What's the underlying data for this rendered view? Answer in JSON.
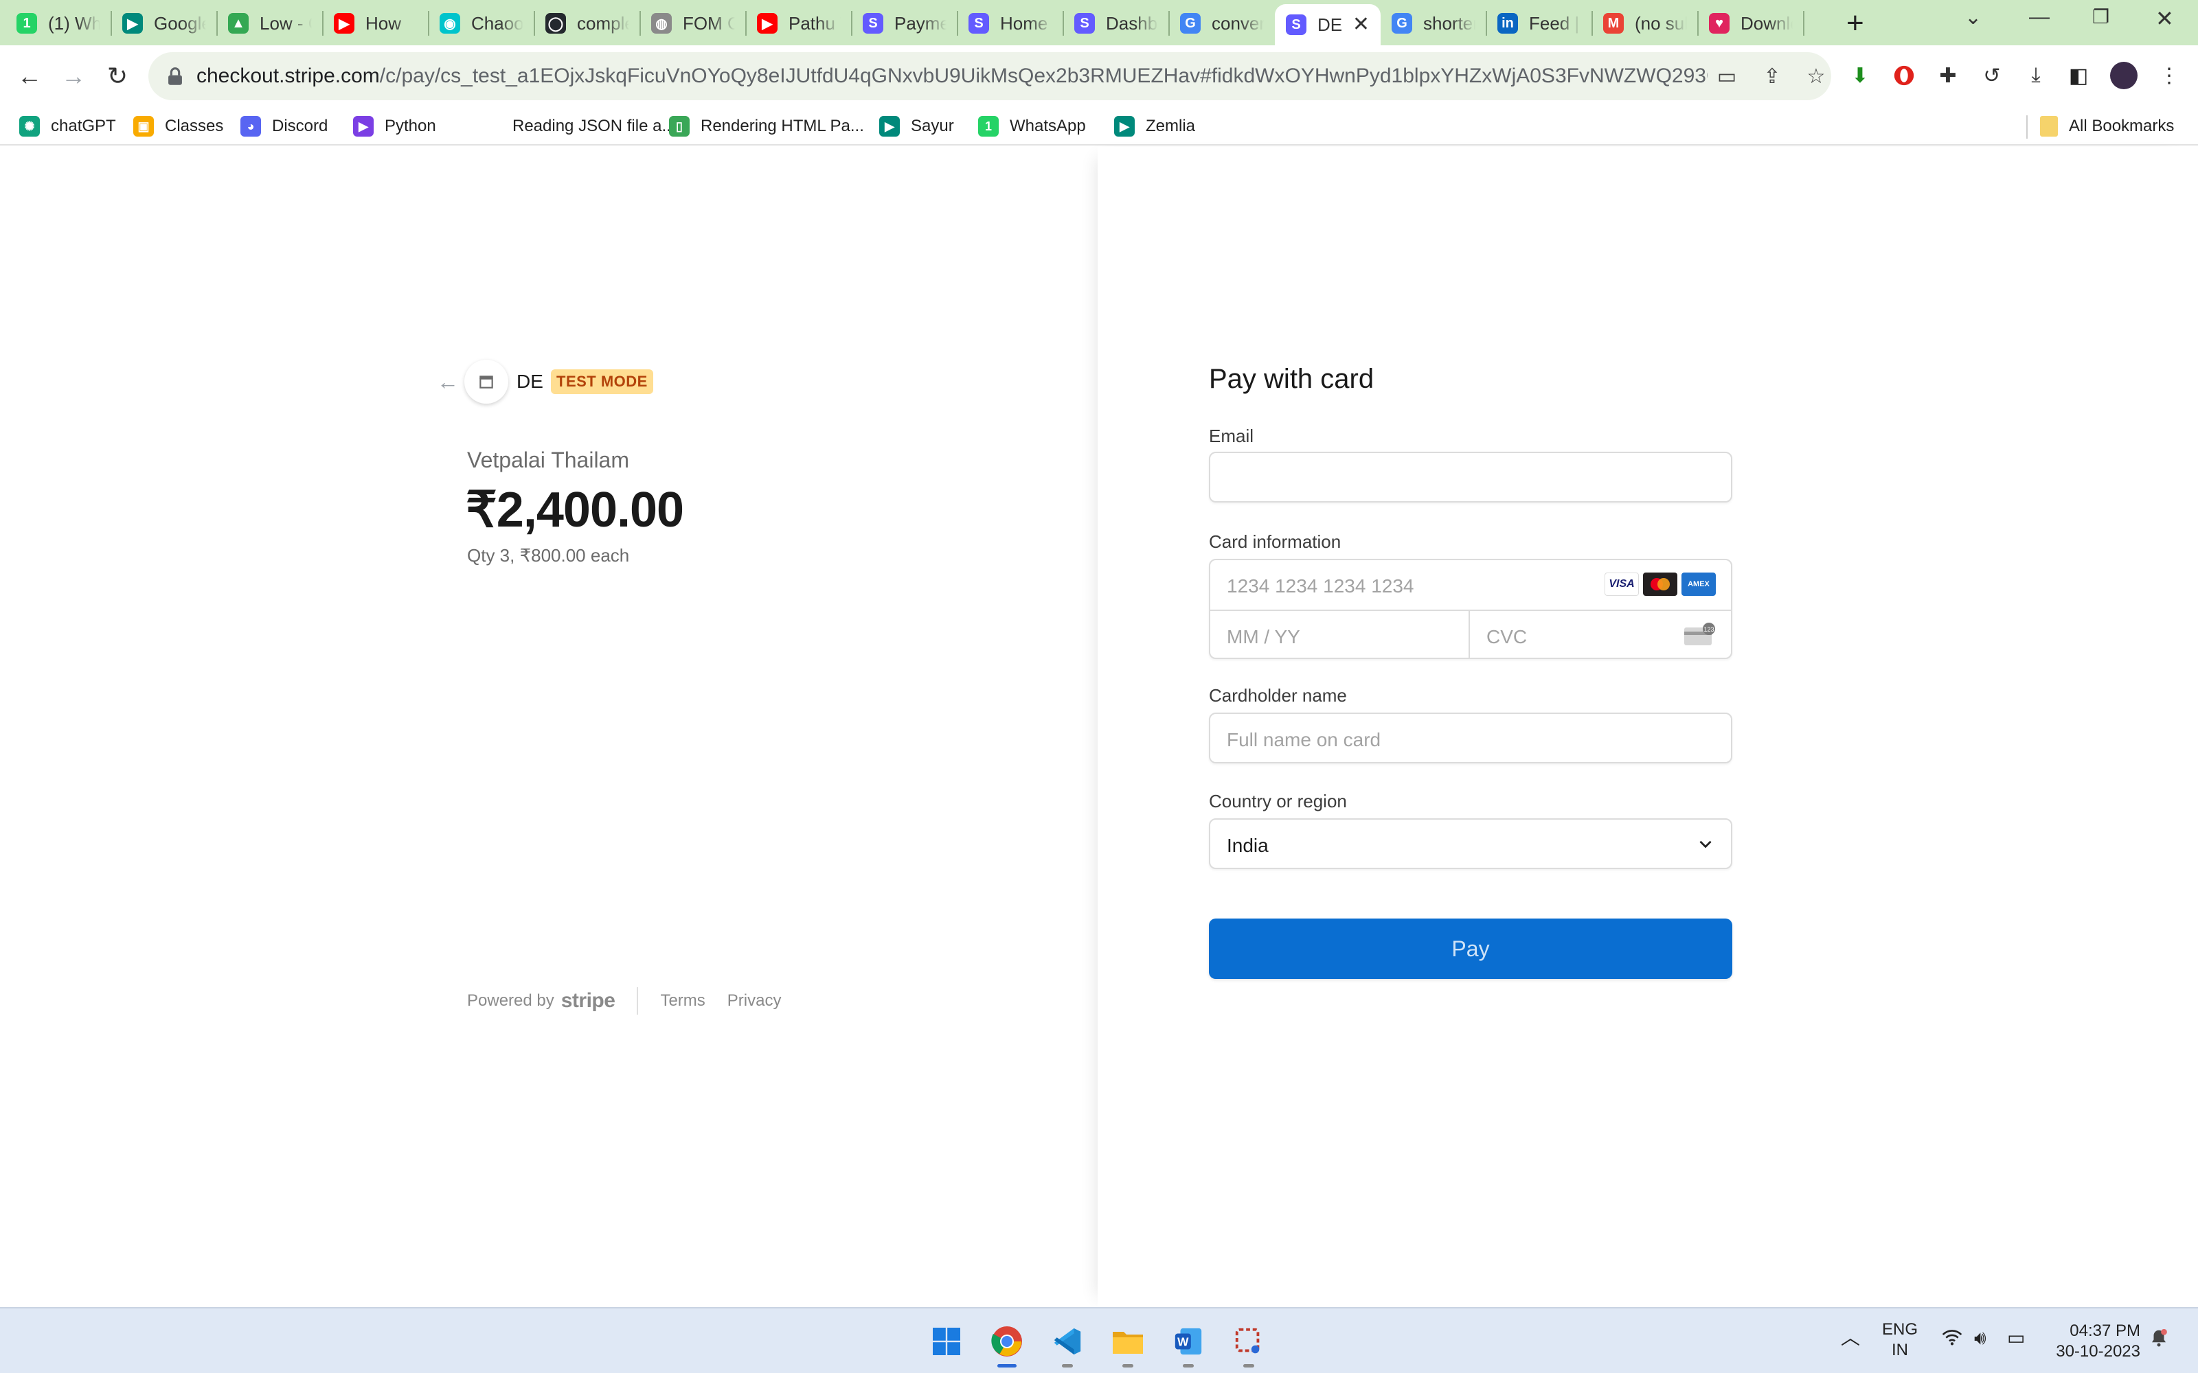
{
  "browser": {
    "tabs": [
      {
        "title": "(1) WhatsApp",
        "icon": "whatsapp-icon",
        "color": "#25d366",
        "glyph": "1"
      },
      {
        "title": "Google Meet",
        "icon": "google-meet-icon",
        "color": "#00897b",
        "glyph": "▶"
      },
      {
        "title": "Low - Google Drive",
        "icon": "google-drive-icon",
        "color": "#34a853",
        "glyph": "▲"
      },
      {
        "title": "How",
        "icon": "youtube-icon",
        "color": "#ff0000",
        "glyph": "▶",
        "prefix": "👉"
      },
      {
        "title": "Chaoo",
        "icon": "chaoo-icon",
        "color": "#00c4cc",
        "glyph": "◉"
      },
      {
        "title": "complete",
        "icon": "github-icon",
        "color": "#24292e",
        "glyph": "◯"
      },
      {
        "title": "FOM G",
        "icon": "globe-icon",
        "color": "#8a8a8a",
        "glyph": "◍"
      },
      {
        "title": "Pathu T",
        "icon": "youtube-icon",
        "color": "#ff0000",
        "glyph": "▶"
      },
      {
        "title": "Payments",
        "icon": "stripe-icon",
        "color": "#635bff",
        "glyph": "S"
      },
      {
        "title": "Home",
        "icon": "stripe-icon",
        "color": "#635bff",
        "glyph": "S"
      },
      {
        "title": "Dashboard",
        "icon": "stripe-icon",
        "color": "#635bff",
        "glyph": "S"
      },
      {
        "title": "convert",
        "icon": "google-icon",
        "color": "#4285f4",
        "glyph": "G"
      },
      {
        "title": "DE",
        "icon": "stripe-icon",
        "color": "#635bff",
        "glyph": "S",
        "active": true
      },
      {
        "title": "shorten",
        "icon": "google-icon",
        "color": "#4285f4",
        "glyph": "G"
      },
      {
        "title": "Feed | LinkedIn",
        "icon": "linkedin-icon",
        "color": "#0a66c2",
        "glyph": "in"
      },
      {
        "title": "(no subject)",
        "icon": "gmail-icon",
        "color": "#ea4335",
        "glyph": "M"
      },
      {
        "title": "Download",
        "icon": "heart-icon",
        "color": "#e0245e",
        "glyph": "♥"
      }
    ],
    "url_host": "checkout.stripe.com",
    "url_path": "/c/pay/cs_test_a1EOjxJskqFicuVnOYoQy8eIJUtfdU4qGNxvbU9UikMsQex2b3RMUEZHav#fidkdWxOYHwnPyd1blpxYHZxWjA0S3FvNWZWQ293QE0wdW5VN...",
    "bookmarks": [
      {
        "label": "chatGPT",
        "icon": "openai-icon",
        "color": "#10a37f",
        "glyph": "✺"
      },
      {
        "label": "Classes",
        "icon": "classroom-icon",
        "color": "#f9ab00",
        "glyph": "▣"
      },
      {
        "label": "Discord",
        "icon": "discord-icon",
        "color": "#5865f2",
        "glyph": "◕"
      },
      {
        "label": "Python",
        "icon": "python-icon",
        "color": "#7b3fe4",
        "glyph": "▶"
      },
      {
        "label": "Reading JSON file a...",
        "icon": "blank-page-icon",
        "color": "#ffffff",
        "glyph": ""
      },
      {
        "label": "Rendering HTML Pa...",
        "icon": "document-icon",
        "color": "#3aa757",
        "glyph": "▯"
      },
      {
        "label": "Sayur",
        "icon": "google-meet-icon",
        "color": "#00897b",
        "glyph": "▶"
      },
      {
        "label": "WhatsApp",
        "icon": "whatsapp-icon",
        "color": "#25d366",
        "glyph": "1"
      },
      {
        "label": "Zemlia",
        "icon": "google-meet-icon",
        "color": "#00897b",
        "glyph": "▶"
      }
    ],
    "all_bookmarks": "All Bookmarks"
  },
  "checkout": {
    "merchant": "DE",
    "test_badge": "TEST MODE",
    "product_name": "Vetpalai Thailam",
    "price": "₹2,400.00",
    "qty_line": "Qty 3, ₹800.00 each",
    "footer": {
      "powered": "Powered by",
      "brand": "stripe",
      "terms": "Terms",
      "privacy": "Privacy"
    }
  },
  "form": {
    "title": "Pay with card",
    "email_label": "Email",
    "email_value": "",
    "card_label": "Card information",
    "card_number_placeholder": "1234 1234 1234 1234",
    "expiry_placeholder": "MM / YY",
    "cvc_placeholder": "CVC",
    "card_brands": [
      "VISA",
      "mastercard",
      "AMEX"
    ],
    "name_label": "Cardholder name",
    "name_placeholder": "Full name on card",
    "country_label": "Country or region",
    "country_value": "India",
    "pay_label": "Pay",
    "pay_color": "#0a6ed1"
  },
  "taskbar": {
    "apps": [
      "windows-start-icon",
      "chrome-icon",
      "vscode-icon",
      "file-explorer-icon",
      "word-icon",
      "snipping-tool-icon"
    ],
    "lang_top": "ENG",
    "lang_bottom": "IN",
    "time": "04:37 PM",
    "date": "30-10-2023"
  }
}
